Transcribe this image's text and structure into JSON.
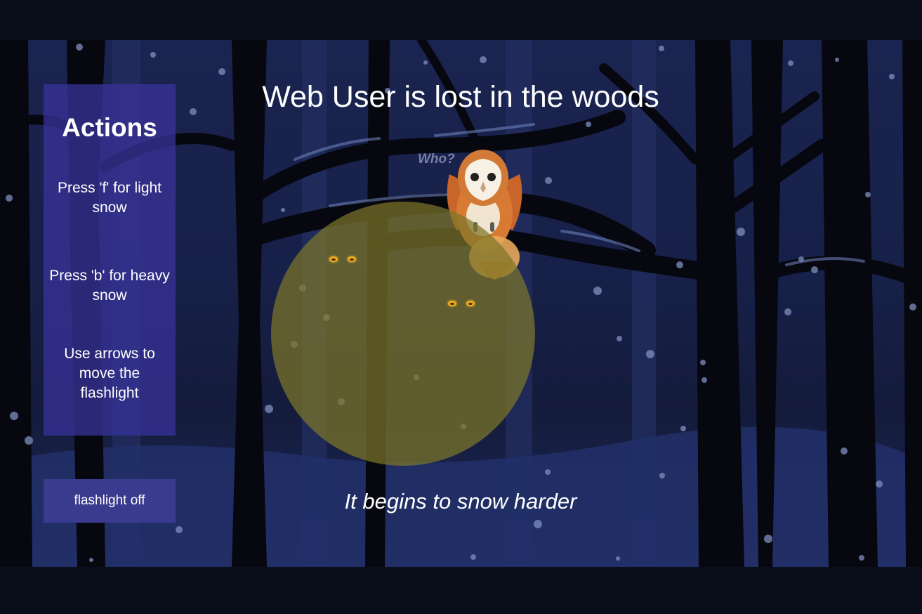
{
  "game": {
    "title": "Web User is lost in the woods",
    "status_text": "It begins to snow harder",
    "owl_speech": "Who?"
  },
  "actions_panel": {
    "heading": "Actions",
    "instructions": [
      "Press 'f' for light snow",
      "Press 'b' for heavy snow",
      "Use arrows to move the flashlight"
    ]
  },
  "flashlight_button": {
    "label": "flashlight off"
  },
  "colors": {
    "panel": "#3732a0",
    "button": "#3a3a8e",
    "flashlight_beam": "#7d7628",
    "eyes": "#f3a814",
    "sky": "#1a2450"
  }
}
